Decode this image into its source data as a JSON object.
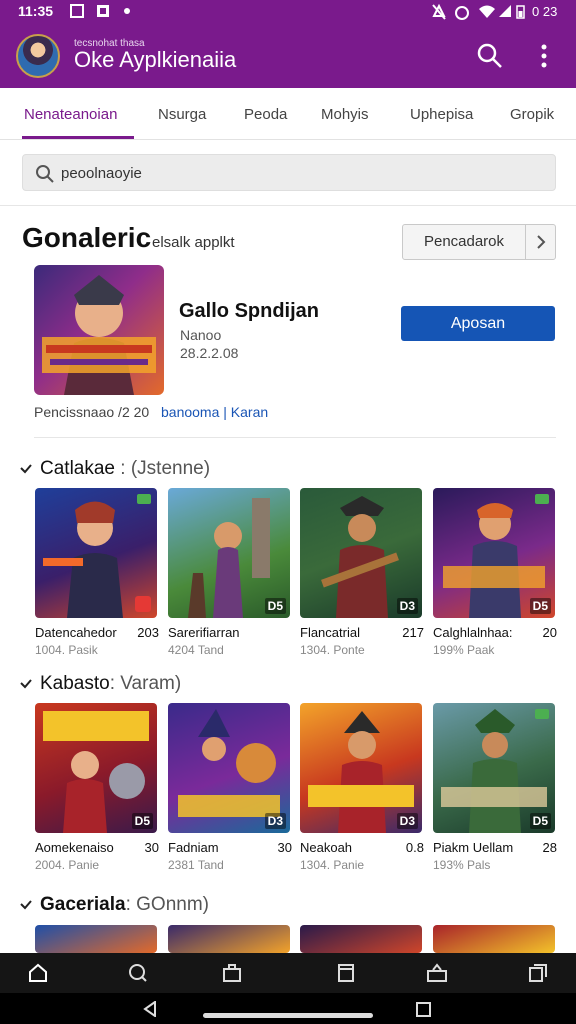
{
  "status": {
    "time": "11:35",
    "battery": "0 23"
  },
  "appbar": {
    "subtitle": "tecsnohat thasa",
    "title": "Oke Ayplkienaiia"
  },
  "tabs": [
    "Nenateanoian",
    "Nsurga",
    "Peoda",
    "Mohyis",
    "Uphepisa",
    "Gropik"
  ],
  "search": {
    "value": "peoolnaoyie"
  },
  "section": {
    "title": "Gonaleric",
    "subtitle": "elsalk  applkt",
    "sort_label": "Pencadarok"
  },
  "featured": {
    "name": "Gallo Spndijan",
    "developer": "Nanoo",
    "date": "28.2.2.08",
    "install_label": "Aposan",
    "meta": "Pencissnaao /2 20",
    "link": "banooma | Karan"
  },
  "categories": [
    {
      "name": "Catlakae",
      "sub": " : (Jstenne)",
      "items": [
        {
          "name": "Datencahedor",
          "num": "203",
          "meta": "1004. Pasik",
          "badge": ""
        },
        {
          "name": "Sarerifiarran",
          "num": "",
          "meta": "4204 Tand",
          "badge": "D5"
        },
        {
          "name": "Flancatrial",
          "num": "217",
          "meta": "1304. Ponte",
          "badge": "D3"
        },
        {
          "name": "Calghlalnhaa:",
          "num": "20",
          "meta": "199% Paak",
          "badge": "D5"
        }
      ]
    },
    {
      "name": "Kabasto",
      "sub": ": Varam)",
      "items": [
        {
          "name": "Aomekenaiso",
          "num": "30",
          "meta": "2004. Panie",
          "badge": "D5"
        },
        {
          "name": "Fadniam",
          "num": "30",
          "meta": "2381 Tand",
          "badge": "D3"
        },
        {
          "name": "Neakoah",
          "num": "0.8",
          "meta": "1304. Panie",
          "badge": "D3"
        },
        {
          "name": "Piakm Uellam",
          "num": "28",
          "meta": "193% Pals",
          "badge": "D5"
        }
      ]
    },
    {
      "name": "Gaceriala",
      "sub": ": GOnnm)",
      "items": []
    }
  ],
  "colors": {
    "brand": "#7a1a8c",
    "install": "#1555b5",
    "link": "#1a55b5"
  },
  "icons": {
    "bottom_nav": [
      "home-icon",
      "search-icon",
      "briefcase-icon",
      "tablet-icon",
      "share-icon",
      "copy-icon"
    ],
    "system_nav": [
      "back-icon",
      "home-pill",
      "recents-icon"
    ]
  }
}
